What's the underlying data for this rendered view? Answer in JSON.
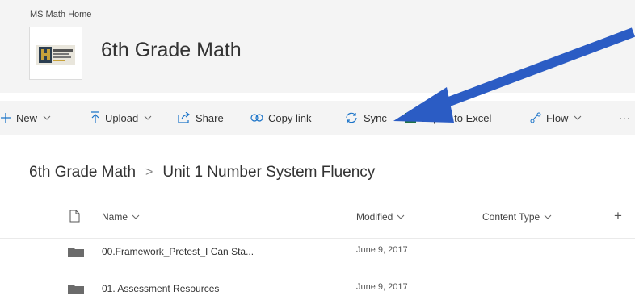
{
  "site": {
    "home_link": "MS Math Home",
    "title": "6th Grade Math"
  },
  "commandbar": {
    "new": "New",
    "upload": "Upload",
    "share": "Share",
    "copy_link": "Copy link",
    "sync": "Sync",
    "export": "Export to Excel",
    "flow": "Flow",
    "more": "···"
  },
  "breadcrumb": {
    "root": "6th Grade Math",
    "separator": ">",
    "current": "Unit 1 Number System Fluency"
  },
  "list": {
    "columns": {
      "name": "Name",
      "modified": "Modified",
      "content_type": "Content Type",
      "add": "+"
    },
    "rows": [
      {
        "name": "00.Framework_Pretest_I Can Sta...",
        "modified": "June 9, 2017"
      },
      {
        "name": "01. Assessment Resources",
        "modified": "June 9, 2017"
      }
    ]
  },
  "colors": {
    "accent": "#1a73c8",
    "arrow": "#2b5cc4",
    "header_bg": "#f4f4f4"
  }
}
